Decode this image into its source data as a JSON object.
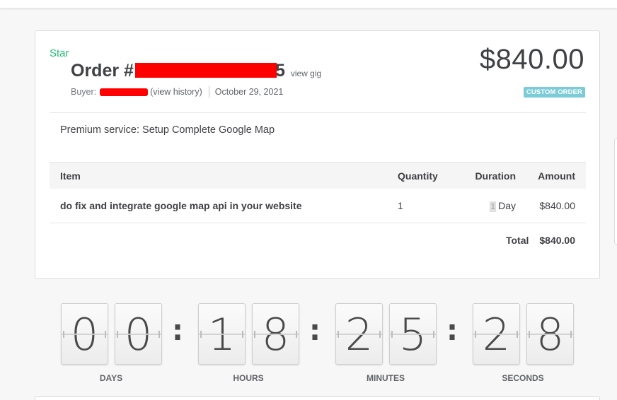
{
  "order": {
    "star_label": "Star",
    "title_prefix": "Order #",
    "title_suffix": "5",
    "view_gig_label": "view gig",
    "buyer_label": "Buyer:",
    "view_history_label": "(view history)",
    "date": "October 29, 2021",
    "price": "$840.00",
    "badge": "CUSTOM ORDER",
    "service_text": "Premium service: Setup Complete Google Map"
  },
  "table": {
    "headers": [
      "Item",
      "Quantity",
      "Duration",
      "Amount"
    ],
    "rows": [
      {
        "item": "do fix and integrate google map api in your website",
        "quantity": "1",
        "duration_num": "1",
        "duration_unit": "Day",
        "amount": "$840.00"
      }
    ],
    "total_label": "Total",
    "total_value": "$840.00"
  },
  "countdown": {
    "days": [
      "0",
      "0"
    ],
    "hours": [
      "1",
      "8"
    ],
    "minutes": [
      "2",
      "5"
    ],
    "seconds": [
      "2",
      "8"
    ],
    "separator": ":",
    "labels": [
      "DAYS",
      "HOURS",
      "MINUTES",
      "SECONDS"
    ]
  },
  "colors": {
    "accent_green": "#1dbf73",
    "badge_bg": "#7ccbd8",
    "redaction": "#ff0000",
    "text_dark": "#404145"
  }
}
